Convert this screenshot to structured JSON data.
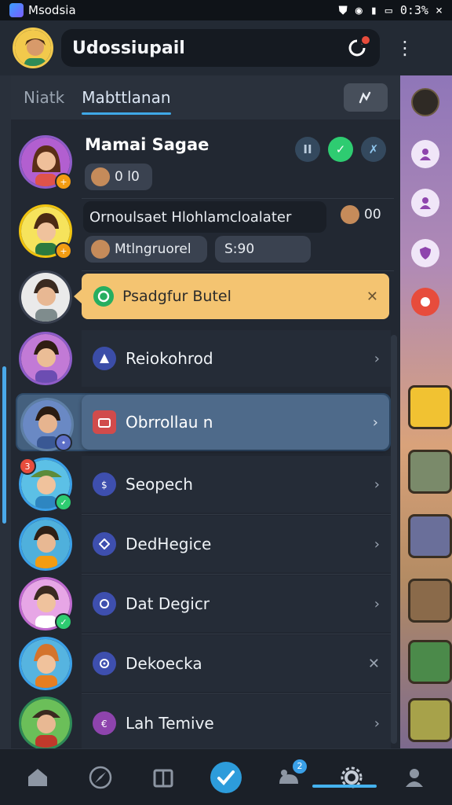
{
  "status_bar": {
    "app_name": "Msodsia",
    "clock": "0:3% ×"
  },
  "header": {
    "title": "Udossiupail"
  },
  "tabs": [
    {
      "label": "Niatk"
    },
    {
      "label": "Mabttlanan"
    }
  ],
  "first_contact": {
    "name": "Mamai Sagae",
    "chip_value": "0 l0",
    "actions": [
      "II",
      "✓",
      "✗"
    ]
  },
  "second_contact": {
    "message": "Ornoulsaet Hlohlamcloalater",
    "side_value": "00",
    "chip_label": "Mtlngruorel",
    "chip_time": "S:90"
  },
  "highlight_card": {
    "label": "Psadgfur Butel"
  },
  "menu_items": [
    {
      "label": "Reiokohrod",
      "icon_color": "#3b4da8"
    },
    {
      "label": "Obrrollau n",
      "icon_color": "#d14b4b"
    },
    {
      "label": "Seopech",
      "icon_color": "#3e4fae"
    },
    {
      "label": "DedHegice",
      "icon_color": "#3e4fae"
    },
    {
      "label": "Dat Degicr",
      "icon_color": "#3e4fae"
    },
    {
      "label": "Dekoecka",
      "icon_color": "#3e4fae"
    },
    {
      "label": "Lah Temive",
      "icon_color": "#8e44ad"
    }
  ],
  "badges": {
    "avatar_7_count": "3",
    "nav_count": "2"
  },
  "colors": {
    "accent": "#3fa8e6",
    "highlight": "#f4c471",
    "selected": "#4e6a8a"
  }
}
